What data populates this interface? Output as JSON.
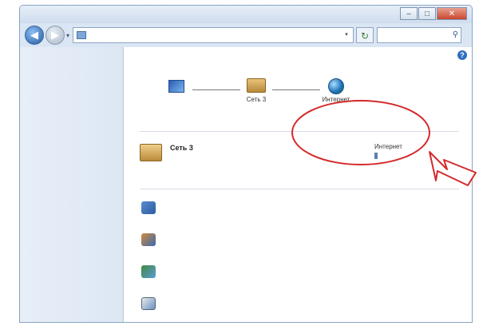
{
  "window": {
    "controls": {
      "minimize": "–",
      "maximize": "□",
      "close": "✕"
    }
  },
  "nav": {
    "back_glyph": "◀",
    "forward_glyph": "▶",
    "history_glyph": "▾",
    "breadcrumb": [
      "",
      "",
      ""
    ],
    "address_dropdown_glyph": "▾",
    "refresh_glyph": "↻",
    "search_placeholder": "",
    "search_glyph": "⚲"
  },
  "sidebar": {
    "items": [
      {
        "label": ""
      },
      {
        "label": ""
      },
      {
        "label": ""
      }
    ],
    "see_also_label": "",
    "see_also_items": [
      {
        "label": ""
      },
      {
        "label": ""
      },
      {
        "label": ""
      },
      {
        "label": ""
      }
    ]
  },
  "main": {
    "help_glyph": "?",
    "title": "",
    "map": {
      "computer_label": "",
      "computer_sub": "",
      "network_label": "Сеть 3",
      "internet_label": "Интернет",
      "full_map_link": ""
    },
    "active": {
      "header": "",
      "connect_disconnect": "",
      "network_name": "Сеть 3",
      "network_type": "",
      "access_key": "",
      "access_value": "Интернет",
      "connections_key": "",
      "connections_value": ""
    },
    "change_header": "",
    "tasks": [
      {
        "icon": "network-setup-icon",
        "title": "",
        "desc": ""
      },
      {
        "icon": "connect-network-icon",
        "title": "",
        "desc": ""
      },
      {
        "icon": "homegroup-icon",
        "title": "",
        "desc": ""
      },
      {
        "icon": "troubleshoot-icon",
        "title": "",
        "desc": ""
      }
    ]
  },
  "colors": {
    "annotation_red": "#d42a2a",
    "link_blue": "#0a3b8c",
    "title_blue": "#1e3f8f"
  }
}
